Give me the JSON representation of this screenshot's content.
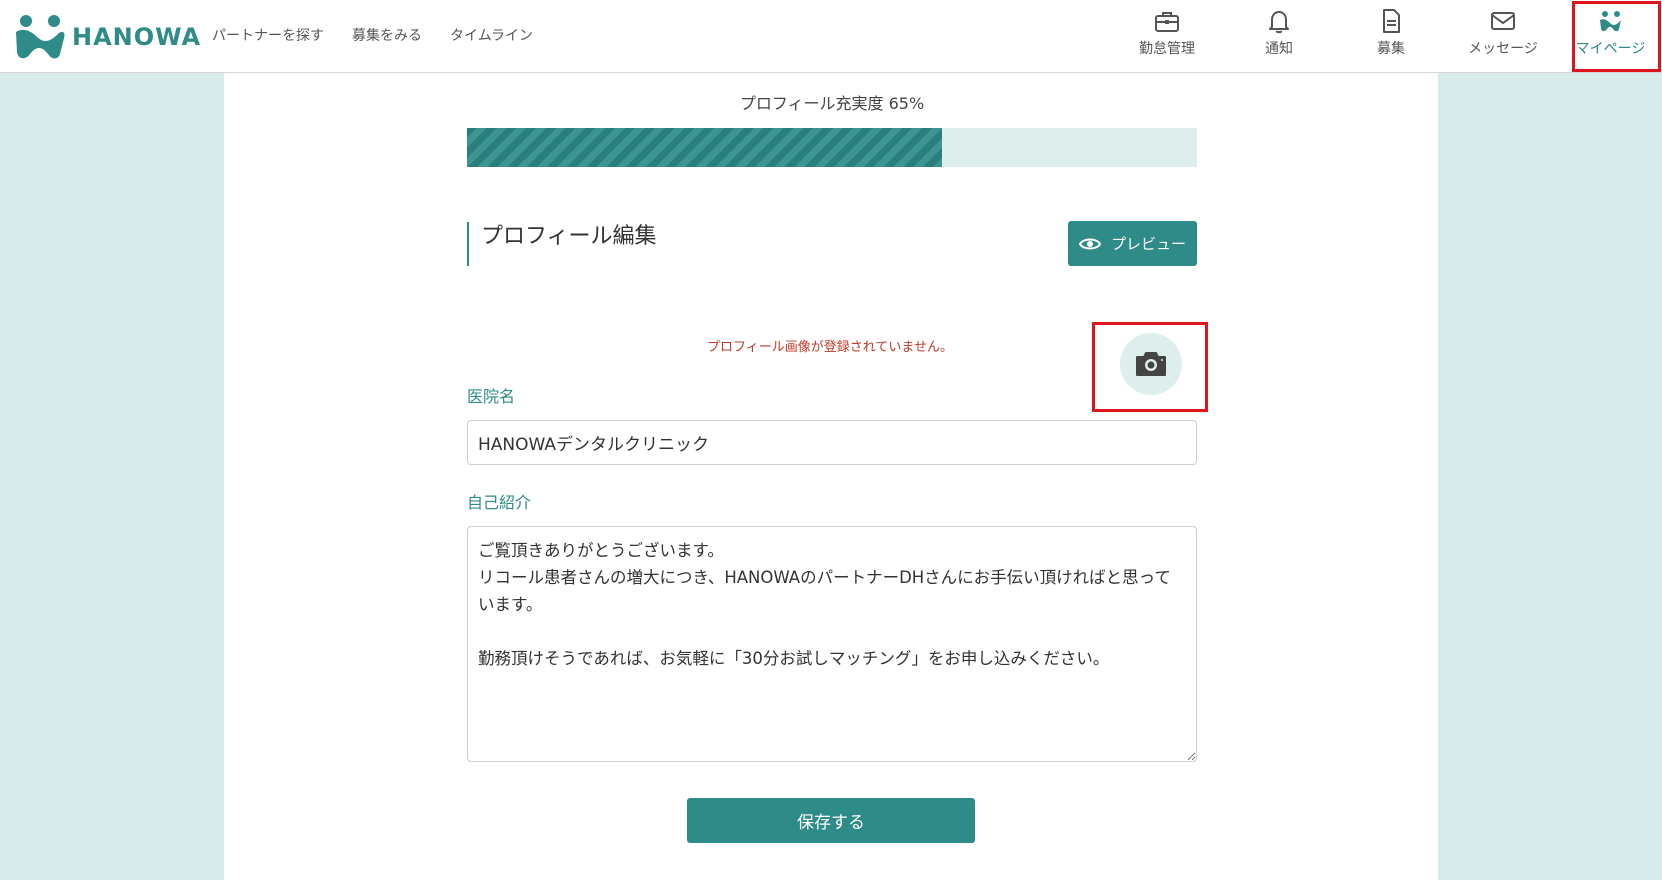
{
  "brand": {
    "name": "HANOWA",
    "color": "#2e8b88"
  },
  "topnav": {
    "items": [
      {
        "label": "パートナーを探す"
      },
      {
        "label": "募集をみる"
      },
      {
        "label": "タイムライン"
      }
    ]
  },
  "iconnav": {
    "items": [
      {
        "label": "勤怠管理",
        "icon": "briefcase-icon"
      },
      {
        "label": "通知",
        "icon": "bell-icon"
      },
      {
        "label": "募集",
        "icon": "document-icon"
      },
      {
        "label": "メッセージ",
        "icon": "envelope-icon"
      },
      {
        "label": "マイページ",
        "icon": "mypage-logo-icon",
        "active": true
      }
    ]
  },
  "profile": {
    "completion_label": "プロフィール充実度 65%",
    "completion_percent": 65,
    "section_title": "プロフィール編集",
    "preview_label": "プレビュー",
    "no_image_warning": "プロフィール画像が登録されていません。",
    "clinic_name_label": "医院名",
    "clinic_name_value": "HANOWAデンタルクリニック",
    "intro_label": "自己紹介",
    "intro_value": "ご覧頂きありがとうございます。\nリコール患者さんの増大につき、HANOWAのパートナーDHさんにお手伝い頂ければと思っています。\n\n勤務頂けそうであれば、お気軽に「30分お試しマッチング」をお申し込みください。",
    "save_label": "保存する"
  },
  "colors": {
    "accent": "#2e8b88",
    "background": "#d8ebea",
    "warning": "#c0392b",
    "highlight": "#e0141c"
  }
}
